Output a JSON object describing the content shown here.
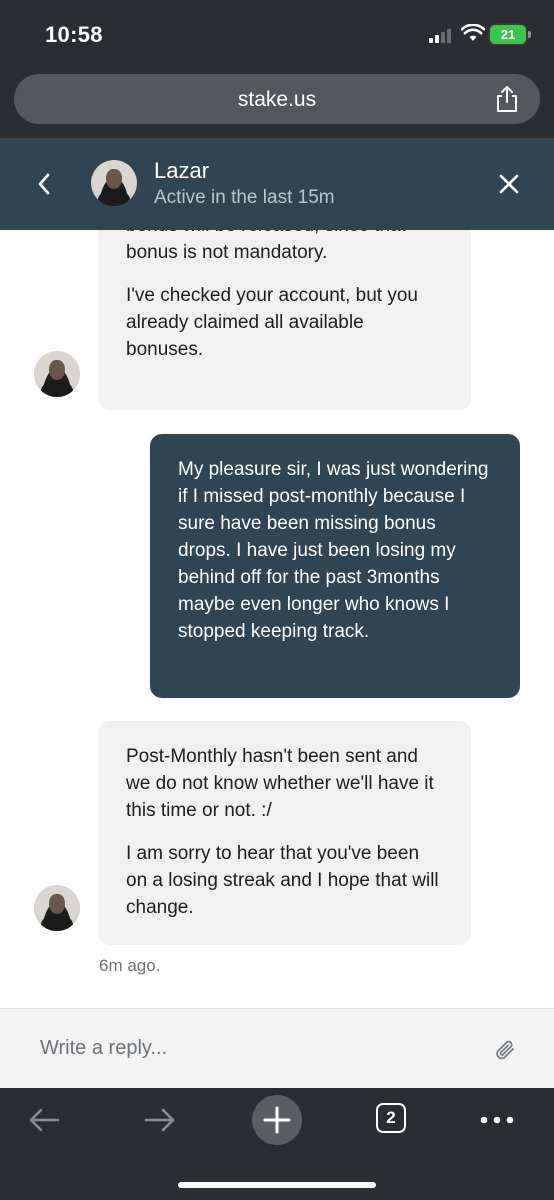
{
  "status_bar": {
    "time": "10:58",
    "battery": "21"
  },
  "browser": {
    "url": "stake.us"
  },
  "chat": {
    "agent_name": "Lazar",
    "agent_status": "Active in the last 15m",
    "messages": {
      "agent_1_part_a": "bonus will be released, since that bonus is not mandatory.",
      "agent_1_part_b": "I've checked your account, but you already claimed all available bonuses.",
      "user_1": "My pleasure sir, I was just wondering if I missed post-monthly because I sure have been missing bonus drops. I have just been losing my behind off for the past 3months maybe even longer who knows I stopped keeping track.",
      "agent_2_part_a": "Post-Monthly hasn't been sent and we do not know whether we'll have it this time or not. :/",
      "agent_2_part_b": "I am sorry to hear that you've been on a losing streak and I hope that will change."
    },
    "timestamp": "6m ago."
  },
  "reply": {
    "placeholder": "Write a reply..."
  },
  "toolbar": {
    "tab_count": "2"
  }
}
